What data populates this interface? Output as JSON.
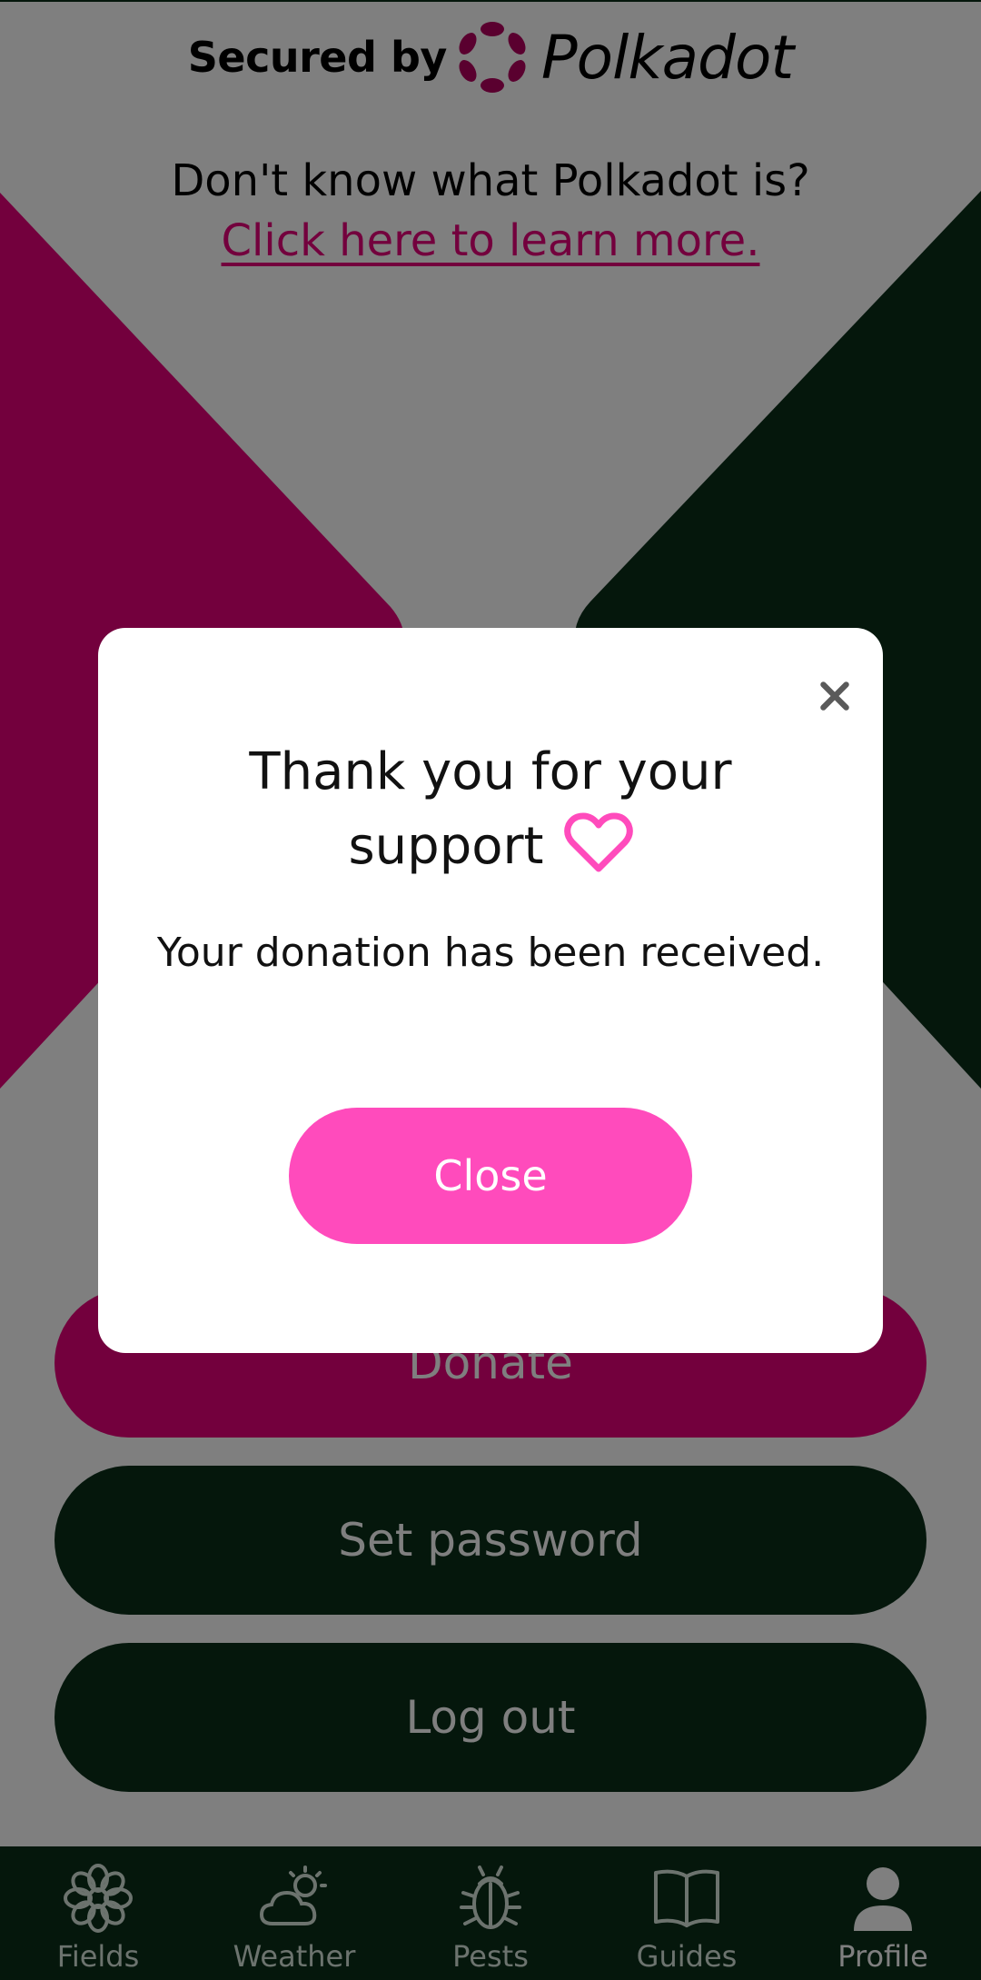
{
  "header": {
    "secured_label": "Secured by",
    "brand_name": "Polkadot",
    "question": "Don't know what Polkadot is?",
    "learn_link": "Click here to learn more."
  },
  "actions": {
    "donate_label": "Donate",
    "set_password_label": "Set password",
    "log_out_label": "Log out"
  },
  "bottom_nav": {
    "items": [
      {
        "label": "Fields",
        "icon": "flower-icon",
        "active": false
      },
      {
        "label": "Weather",
        "icon": "partly-cloudy-icon",
        "active": false
      },
      {
        "label": "Pests",
        "icon": "bug-icon",
        "active": false
      },
      {
        "label": "Guides",
        "icon": "open-book-icon",
        "active": false
      },
      {
        "label": "Profile",
        "icon": "person-icon",
        "active": true
      }
    ]
  },
  "dialog": {
    "title": "Thank you for your support",
    "message": "Your donation has been received.",
    "close_button_label": "Close",
    "close_icon": "close-icon",
    "title_icon": "heart-icon"
  },
  "colors": {
    "polkadot_pink": "#e6007a",
    "dark_green": "#0a2e19",
    "dialog_button_pink": "#ff4bbc",
    "scrim": "rgba(0,0,0,0.5)"
  }
}
